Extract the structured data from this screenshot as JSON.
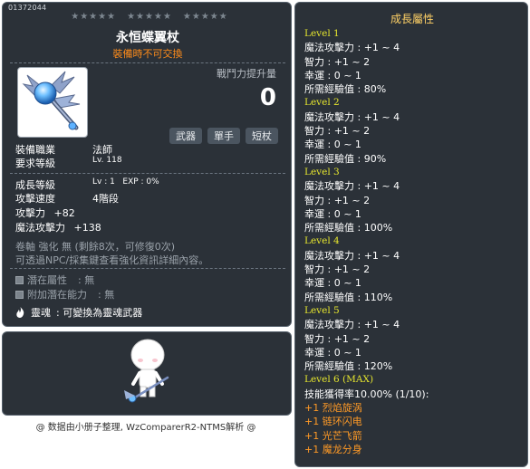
{
  "item": {
    "id": "01372044",
    "stars_groups": [
      "★★★★★",
      "★★★★★",
      "★★★★★"
    ],
    "name": "永恒蝶翼杖",
    "subtitle": "裝備時不可交換",
    "power_label": "戰鬥力提升量",
    "power_value": "0",
    "tags": [
      "武器",
      "單手",
      "短杖"
    ],
    "job_label": "裝備職業",
    "job_value": "法師",
    "req_level_label": "要求等級",
    "req_level_value": "Lv. 118",
    "growth_level_label": "成長等級",
    "growth_level_value": "Lv : 1   EXP : 0%",
    "attack_speed_label": "攻擊速度",
    "attack_speed_value": "4階段",
    "attack_label": "攻擊力",
    "attack_value": "+82",
    "magic_attack_label": "魔法攻擊力",
    "magic_attack_value": "+138",
    "scroll_line": "卷軸 強化 無 (剩餘8次，可修復0次)",
    "npc_line": "可透過NPC/採集鍵查看強化資訊詳細內容。",
    "potential_label": "潛在屬性",
    "potential_value": ": 無",
    "bonus_potential_label": "附加潛在能力",
    "bonus_potential_value": ": 無",
    "soul_label": "靈魂",
    "soul_value": ": 可變換為靈魂武器"
  },
  "credit": "@ 数据由小册子整理, WzComparerR2-NTMS解析 @",
  "growth": {
    "title": "成長屬性",
    "levels": [
      {
        "label": "Level 1",
        "stats": [
          "魔法攻擊力 : +1 ~ 4",
          "智力 : +1 ~ 2",
          "幸運 : 0 ~ 1",
          "所需經驗值 : 80%"
        ]
      },
      {
        "label": "Level 2",
        "stats": [
          "魔法攻擊力 : +1 ~ 4",
          "智力 : +1 ~ 2",
          "幸運 : 0 ~ 1",
          "所需經驗值 : 90%"
        ]
      },
      {
        "label": "Level 3",
        "stats": [
          "魔法攻擊力 : +1 ~ 4",
          "智力 : +1 ~ 2",
          "幸運 : 0 ~ 1",
          "所需經驗值 : 100%"
        ]
      },
      {
        "label": "Level 4",
        "stats": [
          "魔法攻擊力 : +1 ~ 4",
          "智力 : +1 ~ 2",
          "幸運 : 0 ~ 1",
          "所需經驗值 : 110%"
        ]
      },
      {
        "label": "Level 5",
        "stats": [
          "魔法攻擊力 : +1 ~ 4",
          "智力 : +1 ~ 2",
          "幸運 : 0 ~ 1",
          "所需經驗值 : 120%"
        ]
      }
    ],
    "max_label": "Level 6 (MAX)",
    "max_skill_line": "技能獲得率10.00% (1/10):",
    "skills": [
      "+1 烈焰旋涡",
      "+1 链环闪电",
      "+1 光芒飞箭",
      "+1 魔龙分身"
    ]
  },
  "colors": {
    "panel_bg": "#2b3138",
    "subtitle": "#ff8c1a",
    "level_heading": "#e6e62e",
    "skill_text": "#ff9a26",
    "growth_title": "#ffd166"
  }
}
